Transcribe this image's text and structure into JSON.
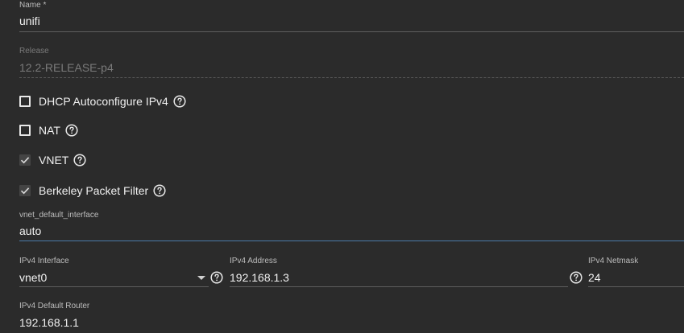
{
  "name": {
    "label": "Name *",
    "value": "unifi"
  },
  "release": {
    "label": "Release",
    "value": "12.2-RELEASE-p4"
  },
  "options": {
    "dhcp": {
      "label": "DHCP Autoconfigure IPv4",
      "checked": false
    },
    "nat": {
      "label": "NAT",
      "checked": false
    },
    "vnet": {
      "label": "VNET",
      "checked": true
    },
    "bpf": {
      "label": "Berkeley Packet Filter",
      "checked": true
    }
  },
  "vnet_default_interface": {
    "label": "vnet_default_interface",
    "value": "auto"
  },
  "ipv4_interface": {
    "label": "IPv4 Interface",
    "value": "vnet0"
  },
  "ipv4_address": {
    "label": "IPv4 Address",
    "value": "192.168.1.3"
  },
  "ipv4_netmask": {
    "label": "IPv4 Netmask",
    "value": "24"
  },
  "ipv4_default_router": {
    "label": "IPv4 Default Router",
    "value": "192.168.1.1"
  },
  "colors": {
    "focus_accent": "#4a7aa8",
    "background": "#2b2b2b"
  },
  "icons": {
    "help": "help-circle-icon",
    "check": "check-icon",
    "dropdown": "caret-down-icon"
  }
}
